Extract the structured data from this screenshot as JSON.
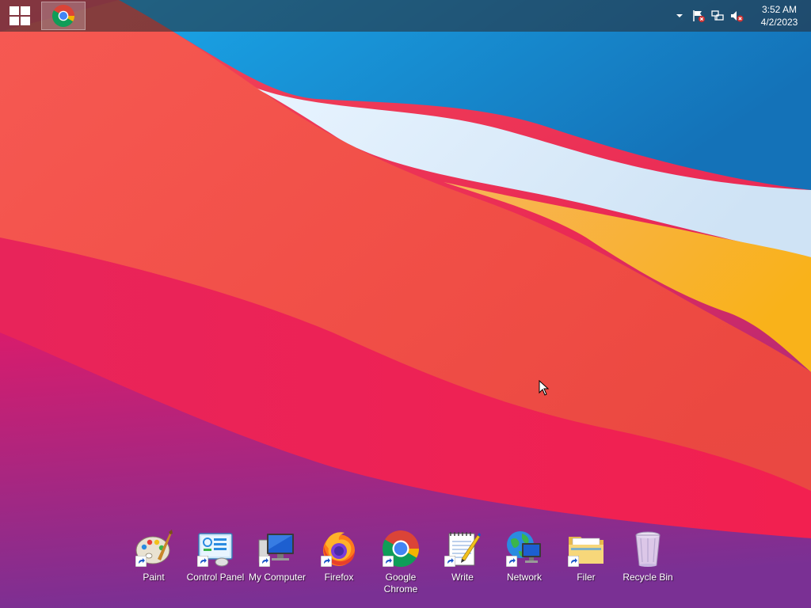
{
  "taskbar": {
    "start_label": "Start",
    "pinned": [
      {
        "name": "Google Chrome",
        "icon": "chrome-icon",
        "active": true
      }
    ],
    "tray": {
      "icons": [
        "expand-tray-icon",
        "action-center-flag-icon",
        "network-disconnected-icon",
        "volume-muted-icon"
      ],
      "time": "3:52 AM",
      "date": "4/2/2023"
    }
  },
  "desktop": {
    "icons": [
      {
        "id": "paint",
        "label": "Paint",
        "icon": "paint-palette-icon"
      },
      {
        "id": "control-panel",
        "label": "Control Panel",
        "icon": "control-panel-icon"
      },
      {
        "id": "my-computer",
        "label": "My Computer",
        "icon": "computer-icon"
      },
      {
        "id": "firefox",
        "label": "Firefox",
        "icon": "firefox-icon"
      },
      {
        "id": "google-chrome",
        "label": "Google\nChrome",
        "icon": "chrome-icon"
      },
      {
        "id": "write",
        "label": "Write",
        "icon": "write-notepad-icon"
      },
      {
        "id": "network",
        "label": "Network",
        "icon": "network-globe-icon"
      },
      {
        "id": "filer",
        "label": "Filer",
        "icon": "folder-icon"
      },
      {
        "id": "recycle-bin",
        "label": "Recycle Bin",
        "icon": "recycle-bin-icon"
      }
    ]
  },
  "colors": {
    "wallpaper_red": "#e8344c",
    "wallpaper_blue": "#1a8fd8",
    "wallpaper_orange": "#f5a623",
    "wallpaper_magenta": "#c0187a"
  }
}
